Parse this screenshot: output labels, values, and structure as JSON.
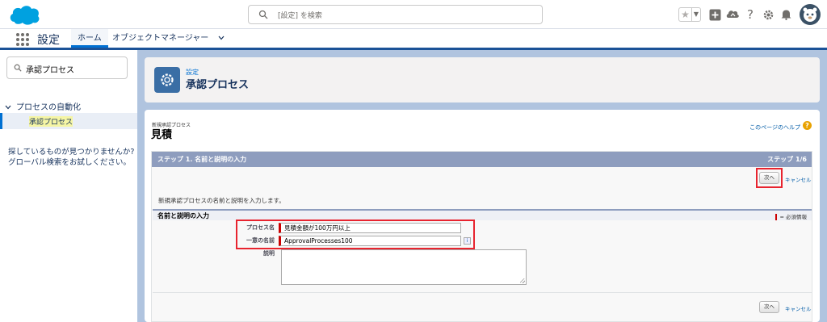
{
  "header": {
    "search_placeholder": "[設定] を検索",
    "icons": [
      "favorites-star-icon",
      "add-icon",
      "trailhead-icon",
      "help-icon",
      "setup-gear-icon",
      "notification-bell-icon",
      "avatar"
    ]
  },
  "nav": {
    "app_name": "設定",
    "tabs": [
      {
        "label": "ホーム",
        "active": true
      },
      {
        "label": "オブジェクトマネージャー",
        "active": false
      }
    ]
  },
  "sidebar": {
    "quickfind_value": "承認プロセス",
    "tree": {
      "parent": "プロセスの自動化",
      "child": "承認プロセス"
    },
    "not_found_line1": "探しているものが見つかりませんか?",
    "not_found_line2": "グローバル検索をお試しください。"
  },
  "page_header": {
    "breadcrumb": "設定",
    "title": "承認プロセス"
  },
  "form": {
    "subheading": "新規承認プロセス",
    "title": "見積",
    "help_link": "このページのヘルプ",
    "step_title": "ステップ 1. 名前と説明の入力",
    "step_counter": "ステップ 1/6",
    "next_label": "次へ",
    "cancel_label": "キャンセル",
    "description": "新規承認プロセスの名前と説明を入力します。",
    "section_title": "名前と説明の入力",
    "required_legend": "= 必須情報",
    "fields": {
      "process_name_label": "プロセス名",
      "process_name_value": "見積金額が100万円以上",
      "unique_name_label": "一意の名前",
      "unique_name_value": "ApprovalProcesses100",
      "description_label": "説明",
      "description_value": ""
    }
  },
  "colors": {
    "brand_blue": "#0070d2",
    "step_bar": "#8e9dbe",
    "highlight_red": "#e8242f",
    "background": "#b0c4df"
  }
}
